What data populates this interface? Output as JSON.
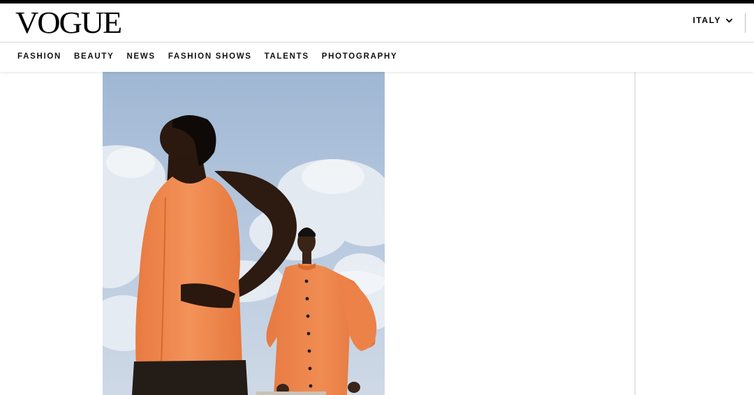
{
  "brand": {
    "logo_text": "VOGUE"
  },
  "edition": {
    "label": "ITALY",
    "icon": "chevron-down-icon"
  },
  "nav": {
    "items": [
      "FASHION",
      "BEAUTY",
      "NEWS",
      "FASHION SHOWS",
      "TALENTS",
      "PHOTOGRAPHY"
    ]
  },
  "colors": {
    "accent_rule": "#000000",
    "garment_orange": "#f0894f",
    "sky": "#a9bfd9"
  }
}
